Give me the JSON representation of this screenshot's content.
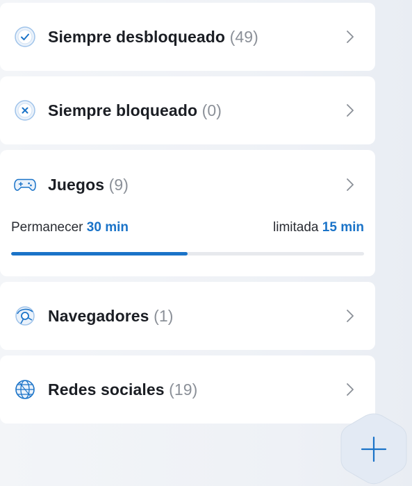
{
  "accent_color": "#1a73c8",
  "categories": [
    {
      "label": "Siempre desbloqueado",
      "count": "(49)",
      "icon": "check-circle-icon"
    },
    {
      "label": "Siempre bloqueado",
      "count": "(0)",
      "icon": "x-circle-icon"
    },
    {
      "label": "Juegos",
      "count": "(9)",
      "icon": "gamepad-icon",
      "limit": {
        "stay_label": "Permanecer",
        "stay_value": "30 min",
        "limit_label": "limitada",
        "limit_value": "15 min",
        "progress_fraction": 0.5
      }
    },
    {
      "label": "Navegadores",
      "count": "(1)",
      "icon": "browser-icon"
    },
    {
      "label": "Redes sociales",
      "count": "(19)",
      "icon": "globe-icon"
    }
  ],
  "fab": {
    "icon": "plus-icon"
  }
}
